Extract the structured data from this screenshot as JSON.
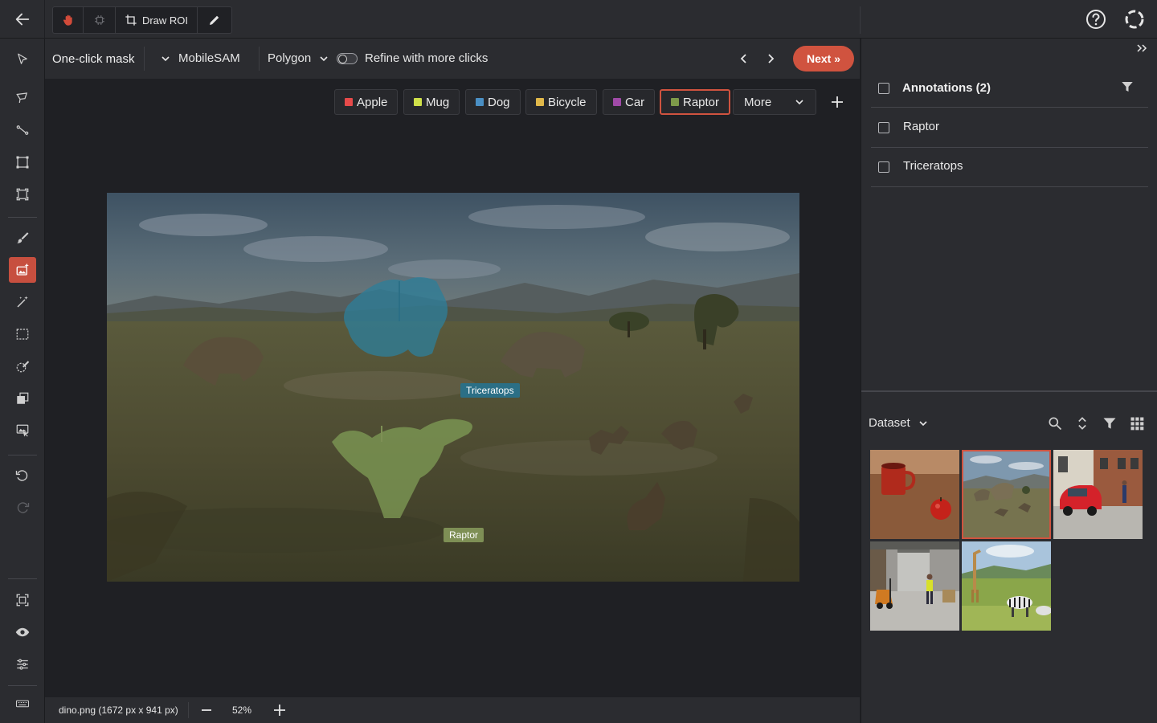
{
  "toolbar": {
    "draw_roi_label": "Draw ROI"
  },
  "subbar": {
    "mode_title": "One-click mask",
    "model": "MobileSAM",
    "output": "Polygon",
    "refine_label": "Refine with more clicks",
    "refine_enabled": false,
    "next_label": "Next »"
  },
  "classes": [
    {
      "label": "Apple",
      "color": "#e64a4a"
    },
    {
      "label": "Mug",
      "color": "#cfe04a"
    },
    {
      "label": "Dog",
      "color": "#4a8fc4"
    },
    {
      "label": "Bicycle",
      "color": "#e0b84a"
    },
    {
      "label": "Car",
      "color": "#a04aa8"
    },
    {
      "label": "Raptor",
      "color": "#7e9a4a",
      "selected": true
    }
  ],
  "more_label": "More",
  "canvas": {
    "annotations": [
      {
        "label": "Triceratops",
        "color": "#2b6f86"
      },
      {
        "label": "Raptor",
        "color": "#7e8f55"
      }
    ]
  },
  "status": {
    "file_info": "dino.png (1672 px x 941 px)",
    "zoom": "52%"
  },
  "annotations_panel": {
    "title": "Annotations (2)",
    "items": [
      {
        "label": "Raptor"
      },
      {
        "label": "Triceratops"
      }
    ]
  },
  "dataset": {
    "label": "Dataset",
    "thumbnails": [
      {
        "name": "mug-apple-thumbnail",
        "selected": false
      },
      {
        "name": "dino-thumbnail",
        "selected": true
      },
      {
        "name": "street-car-thumbnail",
        "selected": false
      },
      {
        "name": "warehouse-thumbnail",
        "selected": false
      },
      {
        "name": "savanna-thumbnail",
        "selected": false
      }
    ]
  },
  "colors": {
    "accent": "#d0533f",
    "background": "#1f2024",
    "panel": "#2b2c30"
  }
}
